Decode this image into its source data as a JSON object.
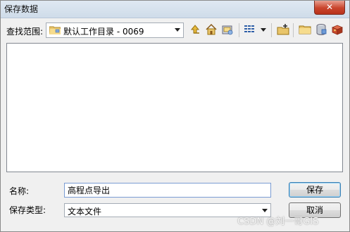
{
  "window": {
    "title": "保存数据",
    "close_label": "✕"
  },
  "lookin": {
    "label": "查找范围:",
    "value": "默认工作目录 - 0069"
  },
  "toolbar": {
    "icons": [
      "up-one-level-icon",
      "home-icon",
      "connect-folder-icon",
      "view-menu-icon",
      "new-folder-icon",
      "folder-icon",
      "database-icon",
      "toolbox-icon"
    ]
  },
  "filename": {
    "label": "名称:",
    "value": "高程点导出"
  },
  "filetype": {
    "label": "保存类型:",
    "value": "文本文件"
  },
  "buttons": {
    "save": "保存",
    "cancel": "取消"
  },
  "watermark": "CSDN @刘一哥GIS",
  "colors": {
    "titlebar": "#d6e1ec",
    "close_button": "#c9442c",
    "list_background": "#ffffff",
    "window_background": "#f0f0f0"
  }
}
